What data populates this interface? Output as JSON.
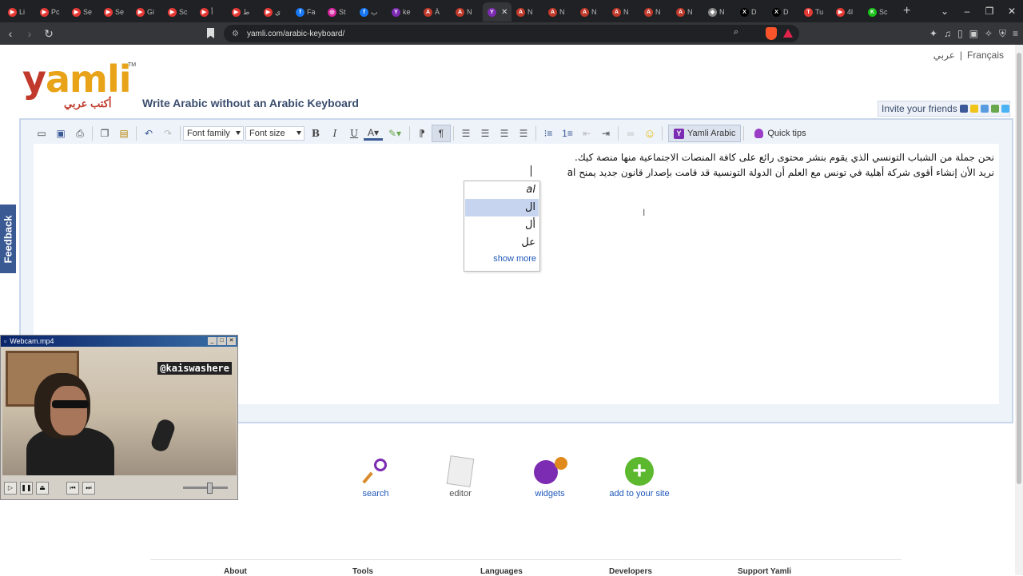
{
  "browser": {
    "tabs": [
      {
        "label": "Li",
        "color": "#e53935",
        "glyph": "▶"
      },
      {
        "label": "Pc",
        "color": "#e53935",
        "glyph": "▶"
      },
      {
        "label": "Se",
        "color": "#e53935",
        "glyph": "▶"
      },
      {
        "label": "Se",
        "color": "#e53935",
        "glyph": "▶"
      },
      {
        "label": "Gi",
        "color": "#e53935",
        "glyph": "▶"
      },
      {
        "label": "Sc",
        "color": "#e53935",
        "glyph": "▶"
      },
      {
        "label": "أ",
        "color": "#e53935",
        "glyph": "▶"
      },
      {
        "label": "ط",
        "color": "#e53935",
        "glyph": "▶"
      },
      {
        "label": "ي",
        "color": "#e53935",
        "glyph": "▶"
      },
      {
        "label": "Fa",
        "color": "#1877f2",
        "glyph": "f"
      },
      {
        "label": "St",
        "color": "#d6249f",
        "glyph": "◎"
      },
      {
        "label": "ب",
        "color": "#1877f2",
        "glyph": "f"
      },
      {
        "label": "ke",
        "color": "#7c2bb3",
        "glyph": "Y"
      },
      {
        "label": "À",
        "color": "#c0392b",
        "glyph": "A"
      },
      {
        "label": "N",
        "color": "#c0392b",
        "glyph": "A"
      },
      {
        "label": "",
        "color": "#7c2bb3",
        "glyph": "Y"
      },
      {
        "label": "N",
        "color": "#c0392b",
        "glyph": "A"
      },
      {
        "label": "N",
        "color": "#c0392b",
        "glyph": "A"
      },
      {
        "label": "N",
        "color": "#c0392b",
        "glyph": "A"
      },
      {
        "label": "N",
        "color": "#c0392b",
        "glyph": "A"
      },
      {
        "label": "N",
        "color": "#c0392b",
        "glyph": "A"
      },
      {
        "label": "N",
        "color": "#c0392b",
        "glyph": "A"
      },
      {
        "label": "N",
        "color": "#888888",
        "glyph": "◆"
      },
      {
        "label": "D",
        "color": "#000000",
        "glyph": "X"
      },
      {
        "label": "D",
        "color": "#000000",
        "glyph": "X"
      },
      {
        "label": "Tu",
        "color": "#e53935",
        "glyph": "T"
      },
      {
        "label": "4l",
        "color": "#e53935",
        "glyph": "▶"
      },
      {
        "label": "Sc",
        "color": "#19c119",
        "glyph": "K"
      }
    ],
    "active_tab_index": 15,
    "tab_close": "✕",
    "new_tab": "+",
    "url": "yamli.com/arabic-keyboard/",
    "win_controls": [
      "⌄",
      "–",
      "❐",
      "✕"
    ]
  },
  "page": {
    "lang_links": {
      "arabic": "عربي",
      "sep": "|",
      "french": "Français"
    },
    "logo": {
      "text_y": "y",
      "text_rest": "amli",
      "tm": "TM",
      "arabic": "أكتب عربي"
    },
    "tagline": "Write Arabic without an Arabic Keyboard",
    "invite": "Invite your friends",
    "toolbar": {
      "font_family": "Font family",
      "font_size": "Font size",
      "yamli_button": "Yamli Arabic",
      "quick_tips": "Quick tips"
    },
    "editor": {
      "line1": "نحن جملة من الشباب التونسي الذي يقوم بنشر محتوى رائع على كافة المنصات الاجتماعية منها منصة كيك.",
      "line2": "نريد الأن إنشاء أقوى شركة أهلية في تونس مع العلم أن الدولة التونسية قد قامت بإصدار قانون جديد يمنح al"
    },
    "suggestions": {
      "items": [
        "al",
        "ال",
        "أل",
        "عل"
      ],
      "selected_index": 1,
      "show_more": "show more"
    },
    "feedback": "Feedback",
    "features": [
      {
        "label": "search",
        "link": true
      },
      {
        "label": "editor",
        "link": false
      },
      {
        "label": "widgets",
        "link": true
      },
      {
        "label": "add to your site",
        "link": true
      }
    ],
    "footer": [
      "About",
      "Tools",
      "Languages",
      "Developers",
      "Support Yamli"
    ]
  },
  "webcam": {
    "title": "Webcam.mp4",
    "handle": "@kaiswashere",
    "buttons": [
      "▷",
      "❚❚",
      "⏏",
      "⏮",
      "⏭"
    ]
  }
}
